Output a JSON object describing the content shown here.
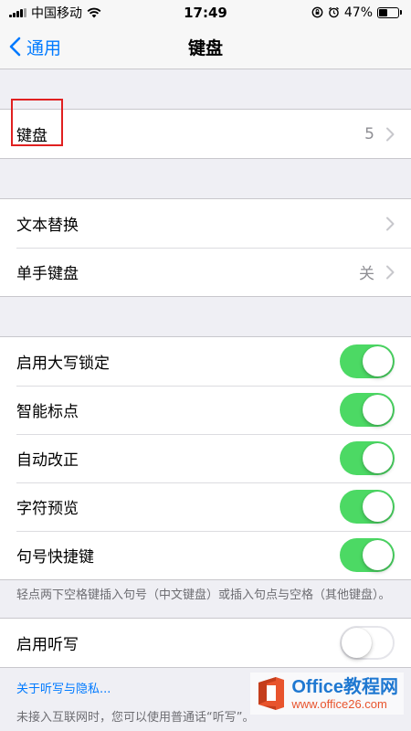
{
  "status_bar": {
    "carrier": "中国移动",
    "time": "17:49",
    "battery_percent": "47%",
    "battery_level": 0.47
  },
  "nav": {
    "back_label": "通用",
    "title": "键盘"
  },
  "keyboards_row": {
    "label": "键盘",
    "value": "5"
  },
  "text_group": [
    {
      "label": "文本替换",
      "value": ""
    },
    {
      "label": "单手键盘",
      "value": "关"
    }
  ],
  "toggles": [
    {
      "label": "启用大写锁定",
      "on": true
    },
    {
      "label": "智能标点",
      "on": true
    },
    {
      "label": "自动改正",
      "on": true
    },
    {
      "label": "字符预览",
      "on": true
    },
    {
      "label": "句号快捷键",
      "on": true
    }
  ],
  "period_footnote": "轻点两下空格键插入句号（中文键盘）或插入句点与空格（其他键盘）。",
  "dictation": {
    "label": "启用听写",
    "on": false
  },
  "dictation_link": "关于听写与隐私...",
  "cut_off_text": "未接入互联网时，您可以使用普通话“听写”。",
  "watermark": {
    "main": "Office教程网",
    "sub": "www.office26.com"
  },
  "colors": {
    "accent": "#007aff",
    "toggle_on": "#4cd964",
    "highlight": "#e02020"
  }
}
